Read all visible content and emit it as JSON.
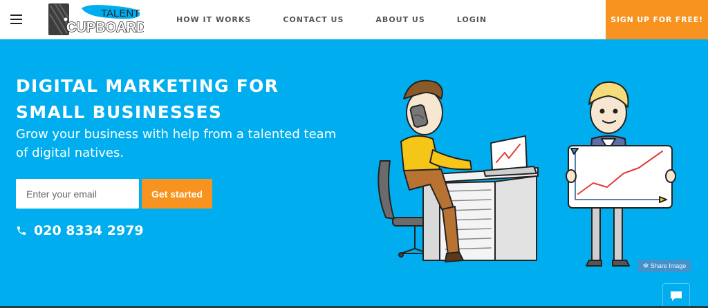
{
  "brand": {
    "logo_top": "TALENT",
    "logo_bottom": "CUPBOARD"
  },
  "nav": {
    "items": [
      {
        "label": "HOW IT WORKS"
      },
      {
        "label": "CONTACT US"
      },
      {
        "label": "ABOUT US"
      },
      {
        "label": "LOGIN"
      }
    ],
    "signup_label": "SIGN UP FOR FREE!"
  },
  "hero": {
    "title_line1": "DIGITAL MARKETING FOR",
    "title_line2": "SMALL BUSINESSES",
    "subtitle_line1": "Grow your business with help from a talented team",
    "subtitle_line2": "of digital natives.",
    "email_placeholder": "Enter your email",
    "cta_label": "Get started",
    "phone": "020 8334 2979"
  },
  "overlay": {
    "share_label": "Share Image"
  },
  "colors": {
    "hero_bg": "#00aeef",
    "accent": "#f7931e",
    "nav_text": "#555555"
  },
  "icons": [
    "menu-icon",
    "phone-icon",
    "layers-icon",
    "chat-icon"
  ]
}
